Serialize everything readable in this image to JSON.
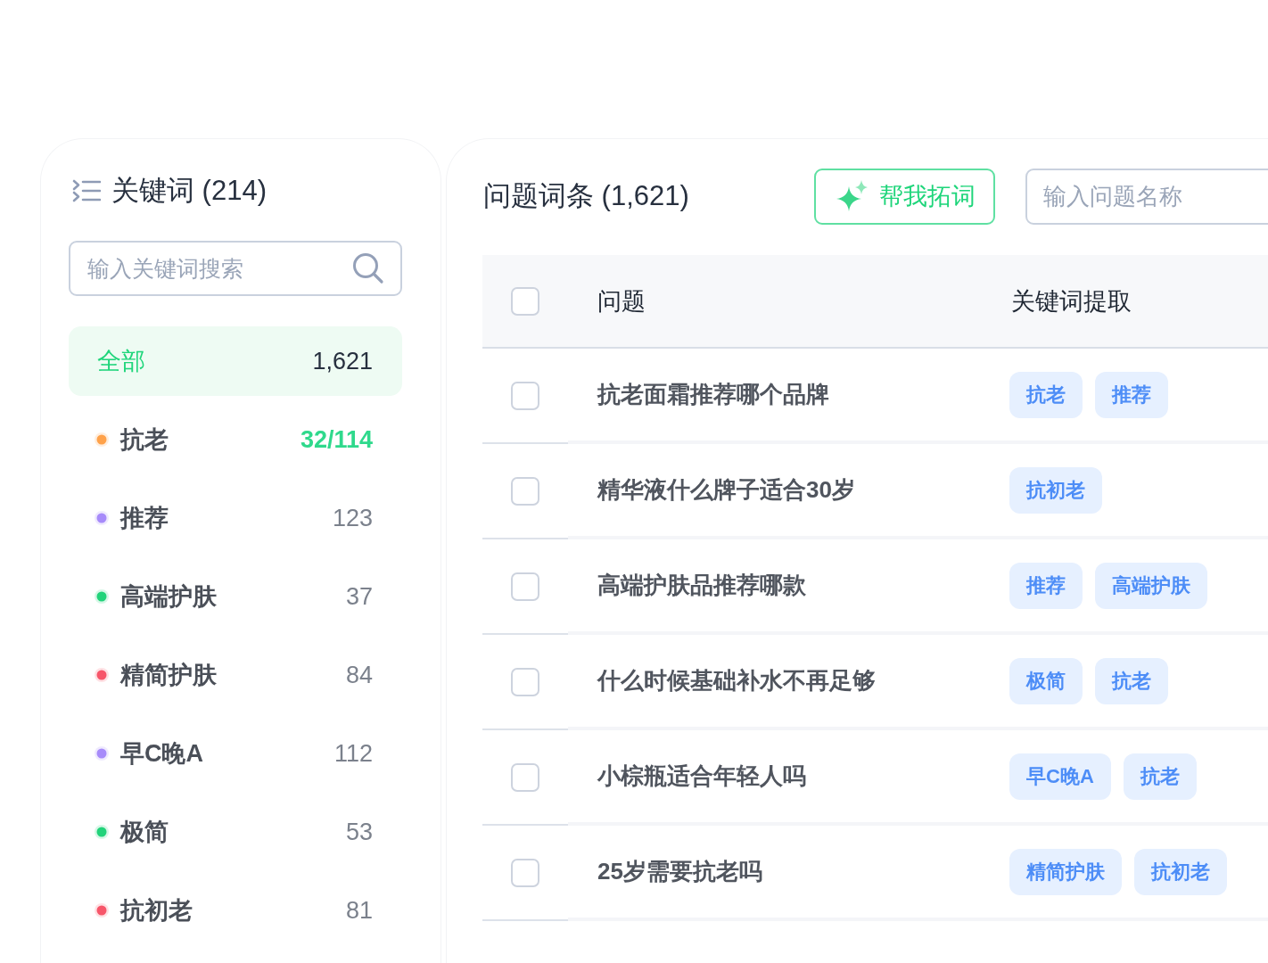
{
  "keyword_panel": {
    "title": "关键词 (214)",
    "search": {
      "placeholder": "输入关键词搜索"
    },
    "items": [
      {
        "label": "全部",
        "count": "1,621",
        "selected": true,
        "highlighted": false
      },
      {
        "label": "抗老",
        "count": "32/114",
        "color": "#ffa24a",
        "selected": false,
        "highlighted": true
      },
      {
        "label": "推荐",
        "count": "123",
        "color": "#a78bfa",
        "selected": false,
        "highlighted": false
      },
      {
        "label": "高端护肤",
        "count": "37",
        "color": "#22d37a",
        "selected": false,
        "highlighted": false
      },
      {
        "label": "精简护肤",
        "count": "84",
        "color": "#f7566a",
        "selected": false,
        "highlighted": false
      },
      {
        "label": "早C晚A",
        "count": "112",
        "color": "#a78bfa",
        "selected": false,
        "highlighted": false
      },
      {
        "label": "极简",
        "count": "53",
        "color": "#22d37a",
        "selected": false,
        "highlighted": false
      },
      {
        "label": "抗初老",
        "count": "81",
        "color": "#f7566a",
        "selected": false,
        "highlighted": false
      }
    ]
  },
  "question_panel": {
    "title": "问题词条 (1,621)",
    "expand_button": {
      "label": "帮我拓词"
    },
    "search": {
      "placeholder": "输入问题名称"
    },
    "table": {
      "columns": [
        "问题",
        "关键词提取"
      ],
      "header_checked": false,
      "rows": [
        {
          "checked": false,
          "question": "抗老面霜推荐哪个品牌",
          "keywords": [
            "抗老",
            "推荐"
          ]
        },
        {
          "checked": false,
          "question": "精华液什么牌子适合30岁",
          "keywords": [
            "抗初老"
          ]
        },
        {
          "checked": false,
          "question": "高端护肤品推荐哪款",
          "keywords": [
            "推荐",
            "高端护肤"
          ]
        },
        {
          "checked": false,
          "question": "什么时候基础补水不再足够",
          "keywords": [
            "极简",
            "抗老"
          ]
        },
        {
          "checked": false,
          "question": "小棕瓶适合年轻人吗",
          "keywords": [
            "早C晚A",
            "抗老"
          ]
        },
        {
          "checked": false,
          "question": "25岁需要抗老吗",
          "keywords": [
            "精简护肤",
            "抗初老"
          ]
        }
      ]
    }
  }
}
